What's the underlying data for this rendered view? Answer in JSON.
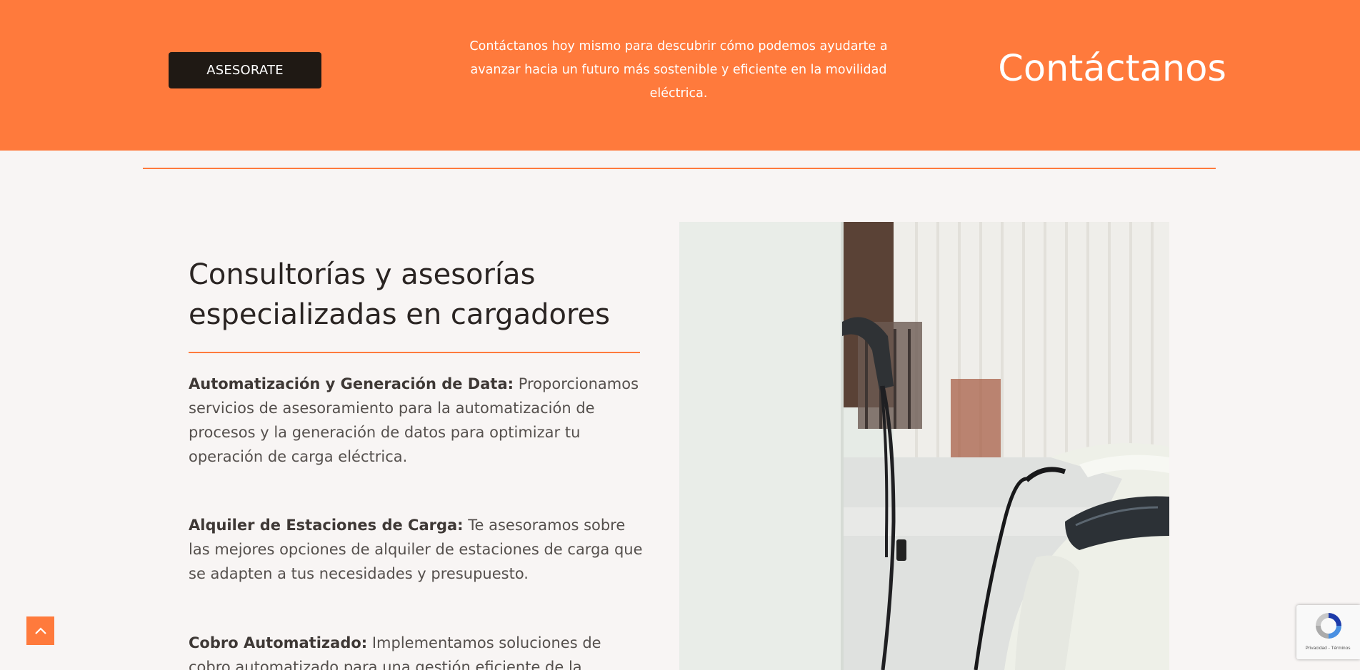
{
  "banner": {
    "button_label": "ASESORATE",
    "text": "Contáctanos hoy mismo para descubrir cómo podemos ayudarte a avanzar hacia un futuro más sostenible y eficiente en la movilidad eléctrica.",
    "title": "Contáctanos"
  },
  "section": {
    "heading": "Consultorías y asesorías especializadas en cargadores",
    "items": [
      {
        "title": "Automatización y Generación de Data:",
        "text": " Proporcionamos servicios de asesoramiento para la automatización de procesos y la generación de datos para optimizar tu operación de carga eléctrica."
      },
      {
        "title": "Alquiler de Estaciones de Carga:",
        "text": " Te asesoramos sobre las mejores opciones de alquiler de estaciones de carga que se adapten a tus necesidades y presupuesto."
      },
      {
        "title": "Cobro Automatizado:",
        "text": " Implementamos soluciones de cobro automatizado para una gestión eficiente de la"
      }
    ]
  },
  "recaptcha": {
    "text": "Privacidad - Términos"
  },
  "colors": {
    "accent": "#ff7a3c",
    "button_bg": "#1f1914",
    "page_bg": "#f8f5f4"
  },
  "icons": {
    "scroll_top": "chevron-up-icon",
    "recaptcha": "recaptcha-icon"
  }
}
